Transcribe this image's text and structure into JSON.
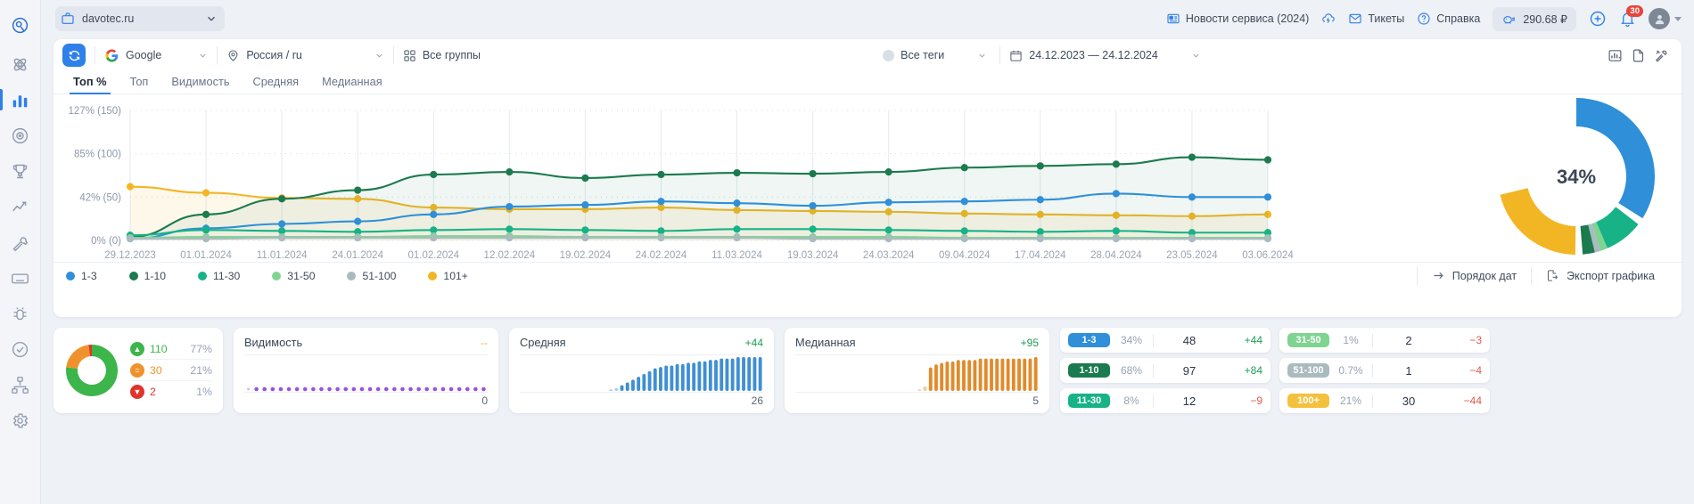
{
  "rail": {
    "items": [
      {
        "name": "logo",
        "icon": "logo-icon"
      },
      {
        "name": "atom",
        "icon": "atom-icon"
      },
      {
        "name": "positions",
        "icon": "bar-chart-icon"
      },
      {
        "name": "analytics",
        "icon": "target-icon"
      },
      {
        "name": "competitors",
        "icon": "trophy-icon"
      },
      {
        "name": "trends",
        "icon": "trend-line-icon"
      },
      {
        "name": "tools",
        "icon": "wrench-icon"
      },
      {
        "name": "keyboard",
        "icon": "keyboard-icon"
      },
      {
        "name": "bug",
        "icon": "bug-icon"
      },
      {
        "name": "audit",
        "icon": "clipboard-check-icon"
      },
      {
        "name": "structure",
        "icon": "sitemap-icon"
      },
      {
        "name": "settings",
        "icon": "gear-icon"
      }
    ]
  },
  "header": {
    "site_icon": "briefcase-icon",
    "site_name": "davotec.ru",
    "news_label": "Новости сервиса (2024)",
    "news_icon": "news-icon",
    "cloud_icon": "cloud-lightning-icon",
    "tickets_label": "Тикеты",
    "tickets_icon": "envelope-icon",
    "help_label": "Справка",
    "help_icon": "question-circle-icon",
    "balance_value": "290.68 ₽",
    "balance_icon": "piggy-bank-icon",
    "plus_icon": "plus-circle-icon",
    "bell_icon": "bell-icon",
    "bell_count": "30",
    "avatar_icon": "user-avatar-icon"
  },
  "filters": {
    "refresh_icon": "refresh-icon",
    "engine_icon": "google-icon",
    "engine": "Google",
    "region_icon": "pin-icon",
    "region": "Россия / ru",
    "groups_icon": "grid-icon",
    "groups": "Все группы",
    "tags": "Все теги",
    "date_icon": "calendar-icon",
    "date_range": "24.12.2023 — 24.12.2024",
    "right_icons": [
      "chart-bars-icon",
      "copy-page-icon",
      "tools-icon"
    ]
  },
  "tabs": [
    {
      "label": "Топ %",
      "active": true
    },
    {
      "label": "Топ",
      "active": false
    },
    {
      "label": "Видимость",
      "active": false
    },
    {
      "label": "Средняя",
      "active": false
    },
    {
      "label": "Медианная",
      "active": false
    }
  ],
  "chart_data": {
    "type": "line",
    "title": "",
    "xlabel": "",
    "ylabel": "",
    "grid": true,
    "legend_position": "bottom",
    "ytick_labels": [
      "127% (150)",
      "85% (100)",
      "42% (50)",
      "0% (0)"
    ],
    "ytick_values": [
      150,
      100,
      50,
      0
    ],
    "ylim": [
      0,
      150
    ],
    "categories": [
      "29.12.2023",
      "01.01.2024",
      "11.01.2024",
      "24.01.2024",
      "01.02.2024",
      "12.02.2024",
      "19.02.2024",
      "24.02.2024",
      "11.03.2024",
      "19.03.2024",
      "24.03.2024",
      "09.04.2024",
      "17.04.2024",
      "28.04.2024",
      "23.05.2024",
      "03.06.2024"
    ],
    "series": [
      {
        "name": "1-3",
        "color": "#2f8fd8",
        "values": [
          2,
          14,
          19,
          22,
          30,
          39,
          41,
          45,
          43,
          40,
          44,
          45,
          47,
          54,
          50,
          50
        ]
      },
      {
        "name": "1-10",
        "color": "#1b7a4e",
        "values": [
          4,
          30,
          48,
          58,
          76,
          79,
          72,
          76,
          78,
          77,
          79,
          84,
          86,
          88,
          96,
          93
        ]
      },
      {
        "name": "11-30",
        "color": "#17b286",
        "values": [
          6,
          12,
          11,
          10,
          12,
          13,
          12,
          11,
          13,
          13,
          12,
          11,
          10,
          11,
          9,
          9
        ]
      },
      {
        "name": "31-50",
        "color": "#7fd491",
        "values": [
          3,
          4,
          4,
          4,
          5,
          5,
          4,
          4,
          4,
          4,
          4,
          3,
          3,
          3,
          3,
          3
        ]
      },
      {
        "name": "51-100",
        "color": "#aabbc0",
        "values": [
          2,
          2,
          3,
          3,
          3,
          3,
          3,
          3,
          3,
          2,
          2,
          2,
          2,
          2,
          2,
          2
        ]
      },
      {
        "name": "101+",
        "color": "#f2b624",
        "values": [
          62,
          55,
          49,
          48,
          38,
          36,
          36,
          38,
          35,
          34,
          33,
          31,
          30,
          29,
          28,
          30
        ]
      }
    ]
  },
  "donut_summary": {
    "center_label": "34%",
    "slices": [
      {
        "name": "1-3",
        "color": "#2f8fd8",
        "percent": 34
      },
      {
        "name": "1-10",
        "color": "#1b7a4e",
        "percent": 2
      },
      {
        "name": "11-30",
        "color": "#17b286",
        "percent": 8
      },
      {
        "name": "31-50",
        "color": "#7fd491",
        "percent": 1
      },
      {
        "name": "51-100",
        "color": "#aabbc0",
        "percent": 1
      },
      {
        "name": "101+",
        "color": "#f2b624",
        "percent": 21
      },
      {
        "name": "rest",
        "color": "#ffffff",
        "percent": 33
      }
    ]
  },
  "legend": [
    {
      "label": "1-3",
      "color": "#2f8fd8"
    },
    {
      "label": "1-10",
      "color": "#1b7a4e"
    },
    {
      "label": "11-30",
      "color": "#17b286"
    },
    {
      "label": "31-50",
      "color": "#7fd491"
    },
    {
      "label": "51-100",
      "color": "#aabbc0"
    },
    {
      "label": "101+",
      "color": "#f2b624"
    }
  ],
  "legend_actions": {
    "date_order_label": "Порядок дат",
    "date_order_icon": "arrow-right-icon",
    "export_label": "Экспорт графика",
    "export_icon": "export-file-icon"
  },
  "dynamics_card": {
    "rows": [
      {
        "icon": "arrow-up-circle-icon",
        "color": "#3cb54a",
        "value": "110",
        "percent": "77%"
      },
      {
        "icon": "equals-circle-icon",
        "color": "#f0922b",
        "value": "30",
        "percent": "21%"
      },
      {
        "icon": "arrow-down-circle-icon",
        "color": "#e0342a",
        "value": "2",
        "percent": "1%"
      }
    ],
    "donut": [
      {
        "color": "#3cb54a",
        "percent": 77
      },
      {
        "color": "#f0922b",
        "percent": 21
      },
      {
        "color": "#e0342a",
        "percent": 2
      }
    ]
  },
  "metrics": [
    {
      "title": "Видимость",
      "delta": "--",
      "delta_kind": "flat",
      "footer": "0",
      "spark_color": "#9b51e0",
      "spark_type": "dots",
      "spark_values": [
        0,
        0,
        0,
        0,
        0,
        0,
        0,
        0,
        0,
        0,
        0,
        0,
        0,
        0,
        0,
        0,
        0,
        0,
        0,
        0,
        0,
        0,
        0,
        0,
        0,
        0,
        0,
        0,
        0,
        0
      ]
    },
    {
      "title": "Средняя",
      "delta": "+44",
      "delta_kind": "up",
      "footer": "26",
      "spark_color": "#3f8fd2",
      "spark_type": "bars",
      "spark_values": [
        0,
        0,
        0,
        0,
        0,
        0,
        0,
        0,
        0,
        0,
        0,
        0,
        0,
        0,
        0,
        0,
        1,
        2,
        4,
        6,
        8,
        10,
        12,
        14,
        16,
        17,
        18,
        18,
        19,
        19,
        20,
        20,
        21,
        21,
        22,
        22,
        23,
        23,
        23,
        24,
        24,
        24,
        24,
        24
      ]
    },
    {
      "title": "Медианная",
      "delta": "+95",
      "delta_kind": "up",
      "footer": "5",
      "spark_color": "#e08b2c",
      "spark_type": "bars",
      "spark_values": [
        0,
        0,
        0,
        0,
        0,
        0,
        0,
        0,
        0,
        0,
        0,
        0,
        0,
        0,
        0,
        0,
        0,
        0,
        0,
        0,
        0,
        0,
        1,
        3,
        16,
        18,
        19,
        20,
        20,
        21,
        21,
        21,
        21,
        22,
        22,
        22,
        22,
        22,
        22,
        22,
        22,
        22,
        22,
        23
      ]
    }
  ],
  "chips": [
    [
      {
        "label": "1-3",
        "color": "#2f8fd8",
        "percent": "34%",
        "count": "48",
        "delta": "+44",
        "kind": "up"
      },
      {
        "label": "1-10",
        "color": "#1b7a4e",
        "percent": "68%",
        "count": "97",
        "delta": "+84",
        "kind": "up"
      },
      {
        "label": "11-30",
        "color": "#17b286",
        "percent": "8%",
        "count": "12",
        "delta": "−9",
        "kind": "down"
      }
    ],
    [
      {
        "label": "31-50",
        "color": "#7fd491",
        "percent": "1%",
        "count": "2",
        "delta": "−3",
        "kind": "down"
      },
      {
        "label": "51-100",
        "color": "#aabbc0",
        "percent": "0.7%",
        "count": "1",
        "delta": "−4",
        "kind": "down"
      },
      {
        "label": "100+",
        "color": "#f4c13d",
        "percent": "21%",
        "count": "30",
        "delta": "−44",
        "kind": "down"
      }
    ]
  ]
}
